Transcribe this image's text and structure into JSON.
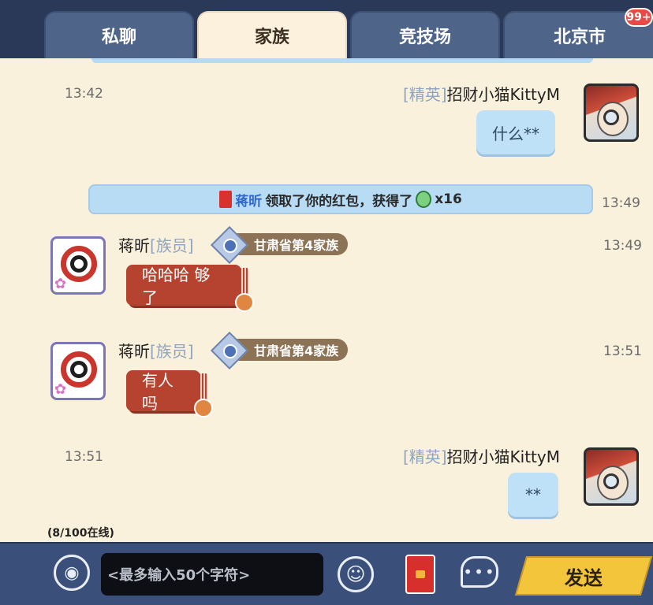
{
  "tabs": [
    {
      "label": "私聊"
    },
    {
      "label": "家族",
      "active": true
    },
    {
      "label": "竞技场"
    },
    {
      "label": "北京市"
    }
  ],
  "badge": "99+",
  "messages": [
    {
      "time": "13:42",
      "rank": "[精英]",
      "name": "招财小猫KittyM",
      "text": "什么**"
    },
    {
      "system": {
        "who": "蒋昕",
        "text": "领取了你的红包，获得了",
        "reward": "x16"
      },
      "time": "13:49"
    },
    {
      "time": "13:49",
      "name": "蒋昕",
      "rank": "[族员]",
      "clan": "甘肃省第4家族",
      "text": "哈哈哈 够了"
    },
    {
      "time": "13:51",
      "name": "蒋昕",
      "rank": "[族员]",
      "clan": "甘肃省第4家族",
      "text": "有人吗"
    },
    {
      "time": "13:51",
      "rank": "[精英]",
      "name": "招财小猫KittyM",
      "text": "**"
    }
  ],
  "online": "(8/100在线)",
  "input": {
    "placeholder": "<最多输入50个字符>"
  },
  "send_label": "发送",
  "icons": {
    "voice": "voice-icon",
    "emoji": "emoji-icon",
    "redpacket": "red-packet-icon",
    "more": "chat-more-icon",
    "clan": "clan-emblem-icon",
    "basketball": "basketball-icon",
    "gem": "gem-icon"
  },
  "colors": {
    "chat_bg": "#faf1dd",
    "bubble_blue": "#bfe1f7",
    "bubble_red": "#b6432f",
    "send_button": "#f2c53a",
    "rank_text": "#8fa4c0"
  }
}
